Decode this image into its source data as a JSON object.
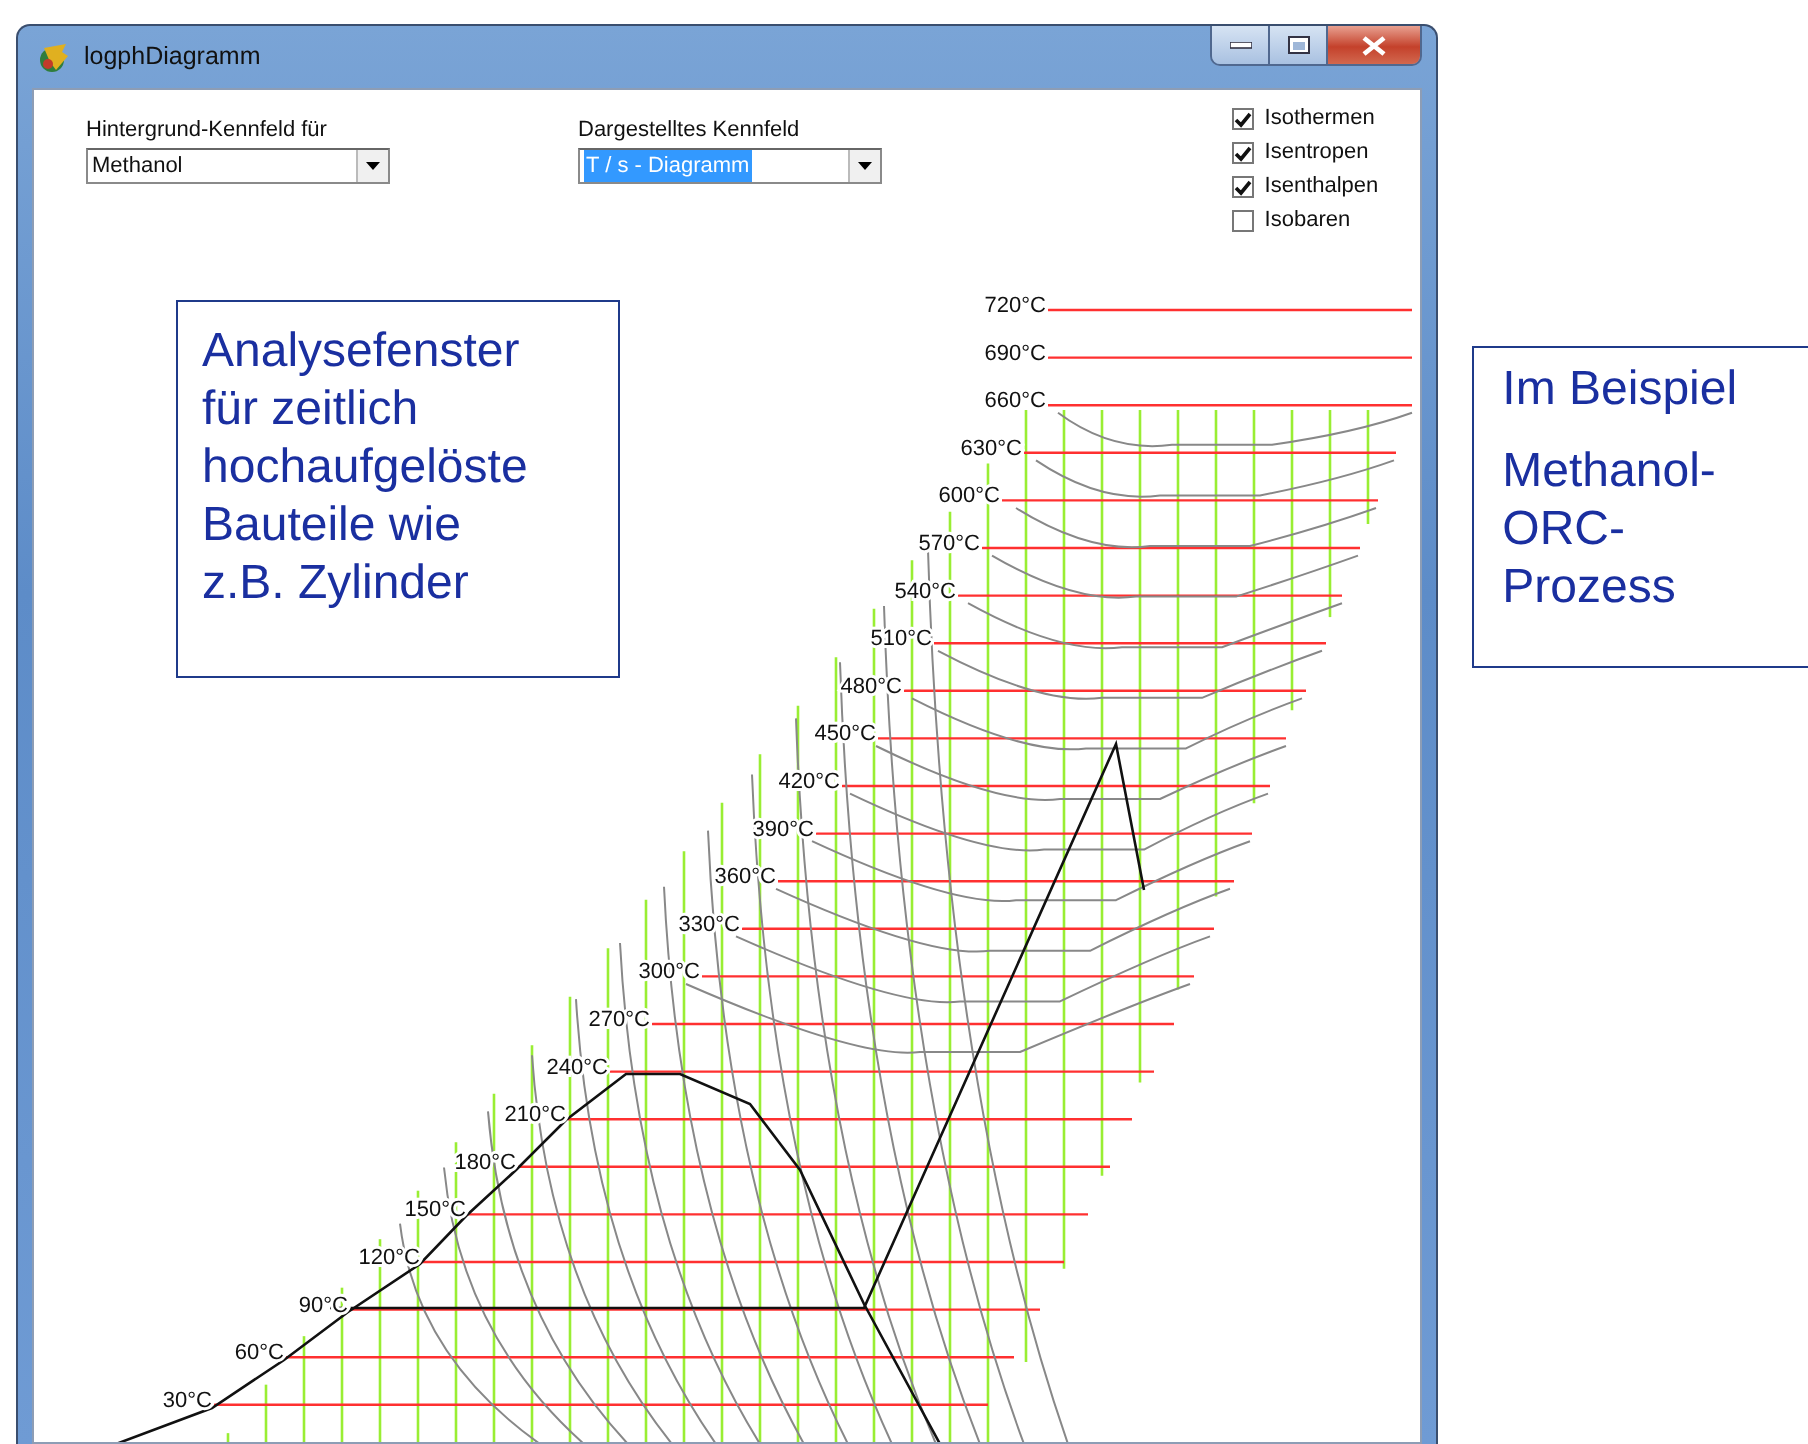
{
  "window": {
    "title": "logphDiagramm"
  },
  "dropdowns": [
    {
      "label": "Hintergrund-Kennfeld für",
      "value": "Methanol",
      "highlighted": false
    },
    {
      "label": "Dargestelltes Kennfeld",
      "value": "T / s - Diagramm",
      "highlighted": true
    }
  ],
  "checkboxes": [
    {
      "label": "Isothermen",
      "checked": true
    },
    {
      "label": "Isentropen",
      "checked": true
    },
    {
      "label": "Isenthalpen",
      "checked": true
    },
    {
      "label": "Isobaren",
      "checked": false
    }
  ],
  "diagram": {
    "isotherm_labels": [
      "720°C",
      "690°C",
      "660°C",
      "630°C",
      "600°C",
      "570°C",
      "540°C",
      "510°C",
      "480°C",
      "450°C",
      "420°C",
      "390°C",
      "360°C",
      "330°C",
      "300°C",
      "270°C",
      "240°C",
      "210°C",
      "180°C",
      "150°C",
      "120°C",
      "90°C",
      "60°C",
      "30°C"
    ]
  },
  "window_callout": {
    "lines": [
      "Analysefenster",
      "für zeitlich",
      "hochaufgelöste",
      "Bauteile wie",
      "z.B. Zylinder"
    ]
  },
  "side_note": {
    "paragraphs": [
      [
        "Im Beispiel"
      ],
      [
        "Methanol-",
        "ORC-",
        "Prozess"
      ]
    ]
  }
}
